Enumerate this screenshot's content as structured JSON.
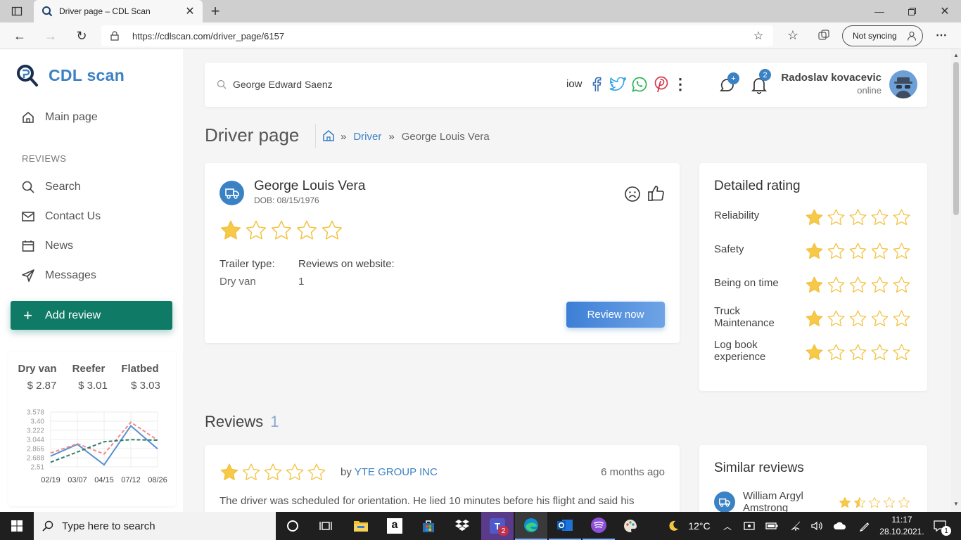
{
  "browser": {
    "tab_title": "Driver page – CDL Scan",
    "url": "https://cdlscan.com/driver_page/6157",
    "sync_label": "Not syncing"
  },
  "sidebar": {
    "brand": "CDL scan",
    "main_page": "Main page",
    "section_reviews": "REVIEWS",
    "items": [
      {
        "label": "Search",
        "icon": "search-icon"
      },
      {
        "label": "Contact Us",
        "icon": "mail-icon"
      },
      {
        "label": "News",
        "icon": "calendar-icon"
      },
      {
        "label": "Messages",
        "icon": "send-icon"
      }
    ],
    "add_review": "Add review",
    "prices": [
      {
        "label": "Dry van",
        "value": "$ 2.87"
      },
      {
        "label": "Reefer",
        "value": "$ 3.01"
      },
      {
        "label": "Flatbed",
        "value": "$ 3.03"
      }
    ]
  },
  "topbar": {
    "search_value": "George Edward Saenz",
    "marquee": "iow",
    "messages_badge": "+",
    "notifications_badge": "2",
    "user_name": "Radoslav kovacevic",
    "user_status": "online"
  },
  "page": {
    "title": "Driver page",
    "crumb_driver": "Driver",
    "crumb_sep": "»",
    "crumb_current": "George Louis Vera"
  },
  "driver": {
    "name": "George Louis Vera",
    "dob": "DOB: 08/15/1976",
    "rating": 1,
    "trailer_label": "Trailer type:",
    "trailer_value": "Dry van",
    "reviews_label": "Reviews on website:",
    "reviews_value": "1",
    "review_btn": "Review now"
  },
  "detailed": {
    "title": "Detailed rating",
    "rows": [
      {
        "label": "Reliability",
        "rating": 1
      },
      {
        "label": "Safety",
        "rating": 1
      },
      {
        "label": "Being on time",
        "rating": 1
      },
      {
        "label": "Truck Maintenance",
        "rating": 1
      },
      {
        "label": "Log book experience",
        "rating": 1
      }
    ]
  },
  "reviews": {
    "title": "Reviews",
    "count": "1",
    "first": {
      "rating": 1,
      "by": "by",
      "author": "YTE GROUP INC",
      "time": "6 months ago",
      "text": "The driver was scheduled for orientation. He lied 10 minutes before his flight and said his"
    }
  },
  "similar": {
    "title": "Similar reviews",
    "item": {
      "name": "William Argyl Amstrong",
      "rating": 1.5
    }
  },
  "chart_data": {
    "type": "line",
    "x": [
      "02/19",
      "03/07",
      "04/15",
      "07/12",
      "08/26"
    ],
    "yticks": [
      "3.578",
      "3.40",
      "3.222",
      "3.044",
      "2.866",
      "2.688",
      "2.51"
    ],
    "ylim": [
      2.51,
      3.578
    ],
    "series": [
      {
        "color": "#5a8fd0",
        "dash": "",
        "points": [
          [
            0,
            2.72
          ],
          [
            1,
            2.95
          ],
          [
            2,
            2.55
          ],
          [
            3,
            3.31
          ],
          [
            4,
            2.86
          ]
        ]
      },
      {
        "color": "#f08a8a",
        "dash": "5,3",
        "points": [
          [
            0,
            2.78
          ],
          [
            1,
            2.96
          ],
          [
            2,
            2.76
          ],
          [
            3,
            3.38
          ],
          [
            4,
            3.03
          ]
        ]
      },
      {
        "color": "#2e7d6b",
        "dash": "5,3",
        "points": [
          [
            0,
            2.6
          ],
          [
            1,
            2.8
          ],
          [
            2,
            3.0
          ],
          [
            3,
            3.04
          ],
          [
            4,
            3.03
          ]
        ]
      }
    ]
  },
  "taskbar": {
    "search_placeholder": "Type here to search",
    "teams_badge": "2",
    "weather": "12°C",
    "time": "11:17",
    "date": "28.10.2021.",
    "notif_count": "1"
  },
  "colors": {
    "accent": "#3b82c4",
    "green": "#0f7a65",
    "star": "#f7c948"
  }
}
